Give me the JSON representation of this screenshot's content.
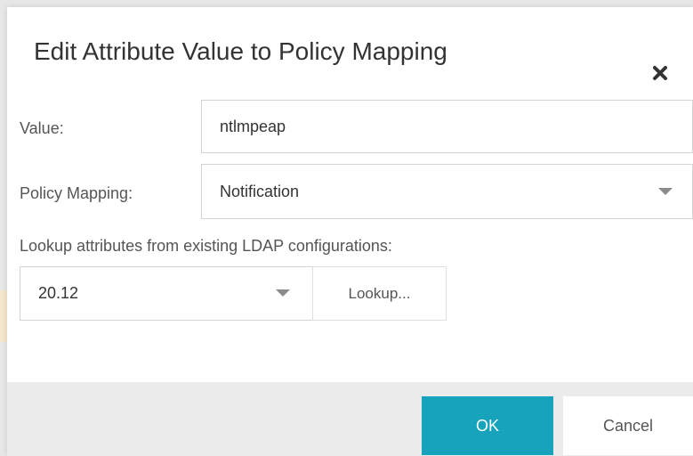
{
  "dialog": {
    "title": "Edit Attribute Value to Policy Mapping",
    "close_icon": "close-icon"
  },
  "form": {
    "value_label": "Value:",
    "value_input": "ntlmpeap",
    "policy_label": "Policy Mapping:",
    "policy_selected": "Notification",
    "lookup_label": "Lookup attributes from existing LDAP configurations:",
    "ldap_selected": "20.12",
    "lookup_button": "Lookup..."
  },
  "footer": {
    "ok_label": "OK",
    "cancel_label": "Cancel"
  },
  "colors": {
    "primary": "#16a3bb",
    "footer_bg": "#ebebeb"
  }
}
